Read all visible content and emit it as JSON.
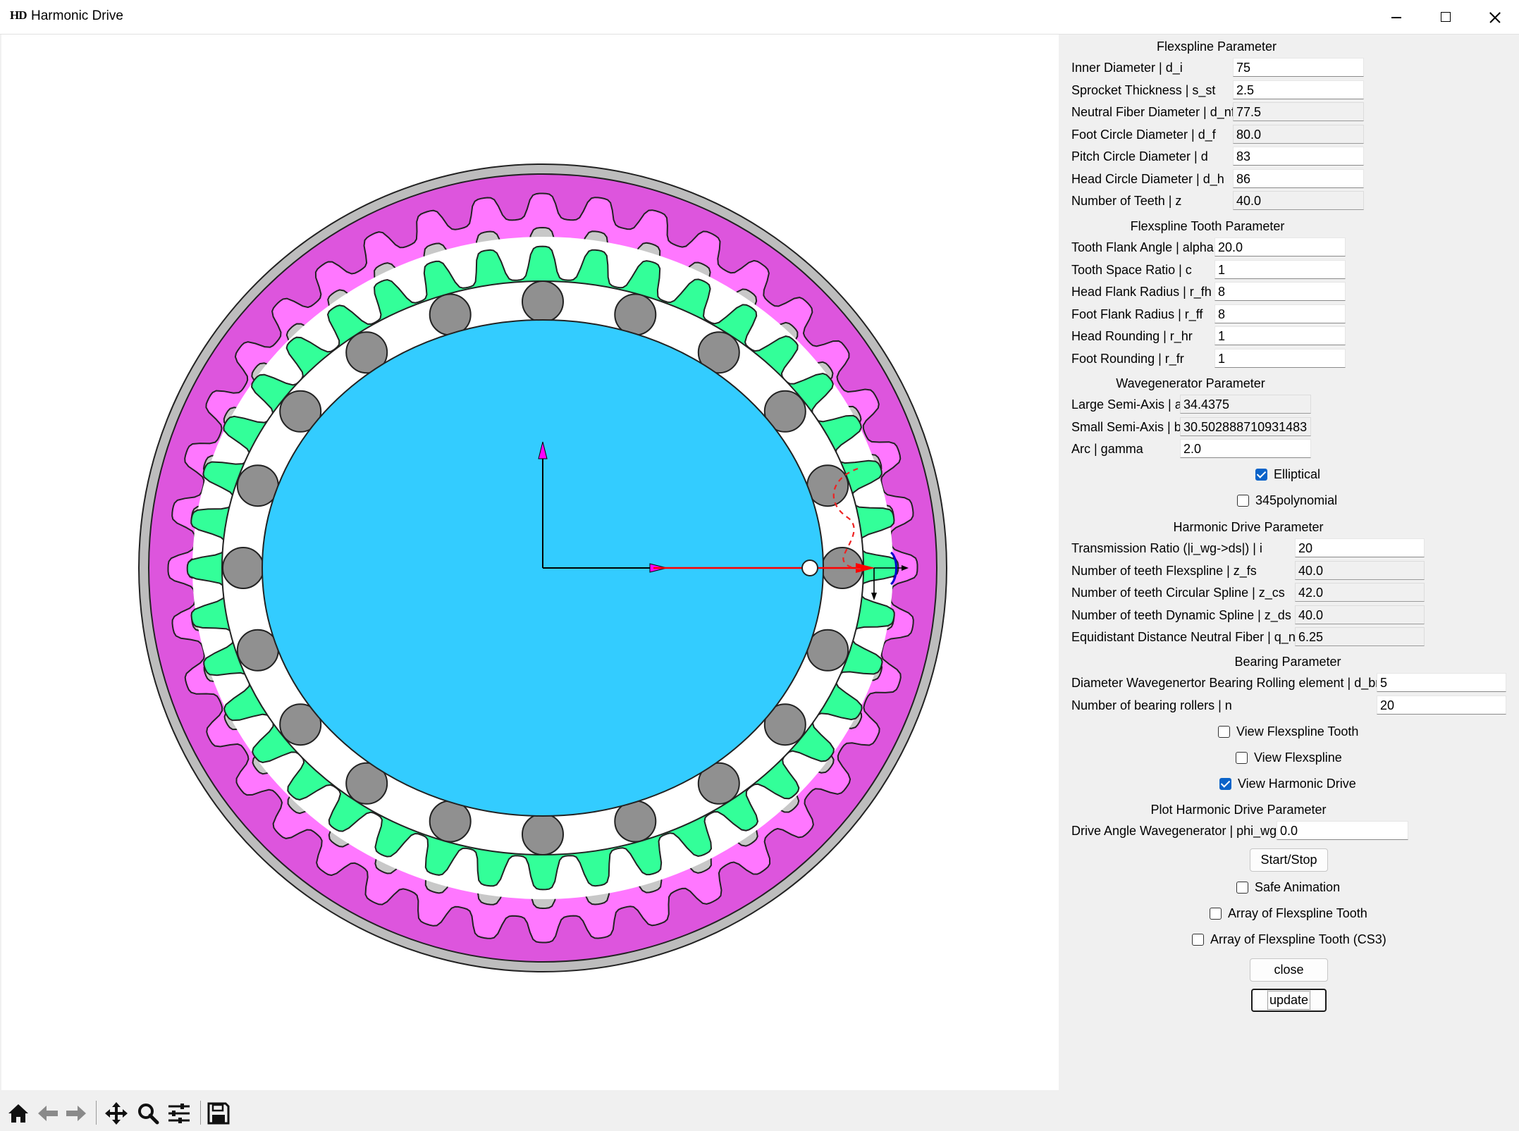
{
  "window": {
    "icon_text": "HD",
    "title": "Harmonic Drive"
  },
  "icons": {
    "minimize": "minimize-icon",
    "maximize": "maximize-icon",
    "close": "close-icon",
    "toolbar": [
      "home-icon",
      "back-arrow-icon",
      "forward-arrow-icon",
      "pan-move-icon",
      "zoom-magnifier-icon",
      "configure-subplots-icon",
      "save-floppy-icon"
    ]
  },
  "colors": {
    "circular_spline_ring": "#bdbdbd",
    "dynamic_spline": "#dd55dd",
    "dynamic_spline_teeth": "#ff77ff",
    "flexspline": "#33ff99",
    "bearing_rollers": "#909090",
    "wave_generator": "#33ccff",
    "x_axis_arrow": "#ff0000",
    "axis_arrow_heads": "#ff00ff",
    "tooth_profile": "#0000cc"
  },
  "panel": {
    "flexspline": {
      "title": "Flexspline Parameter",
      "fields": [
        {
          "label": "Inner Diameter | d_i",
          "value": "75"
        },
        {
          "label": "Sprocket Thickness | s_st",
          "value": "2.5"
        },
        {
          "label": "Neutral Fiber Diameter | d_nf",
          "value": "77.5"
        },
        {
          "label": "Foot Circle Diameter | d_f",
          "value": "80.0"
        },
        {
          "label": "Pitch Circle Diameter | d",
          "value": "83"
        },
        {
          "label": "Head Circle Diameter | d_h",
          "value": "86"
        },
        {
          "label": "Number of Teeth | z",
          "value": "40.0"
        }
      ]
    },
    "tooth": {
      "title": "Flexspline Tooth Parameter",
      "fields": [
        {
          "label": "Tooth Flank Angle | alpha",
          "value": "20.0"
        },
        {
          "label": "Tooth Space Ratio | c",
          "value": "1"
        },
        {
          "label": "Head Flank Radius | r_fh",
          "value": "8"
        },
        {
          "label": "Foot Flank Radius | r_ff",
          "value": "8"
        },
        {
          "label": "Head Rounding | r_hr",
          "value": "1"
        },
        {
          "label": "Foot Rounding | r_fr",
          "value": "1"
        }
      ]
    },
    "wavegen": {
      "title": "Wavegenerator Parameter",
      "fields": [
        {
          "label": "Large Semi-Axis | a",
          "value": "34.4375"
        },
        {
          "label": "Small Semi-Axis | b",
          "value": "30.502888710931483"
        },
        {
          "label": "Arc | gamma",
          "value": "2.0"
        }
      ],
      "elliptical": "Elliptical",
      "polynomial": "345polynomial"
    },
    "hd": {
      "title": "Harmonic Drive Parameter",
      "fields": [
        {
          "label": "Transmission Ratio (|i_wg->ds|) | i",
          "value": "20"
        },
        {
          "label": "Number of teeth Flexspline | z_fs",
          "value": "40.0"
        },
        {
          "label": "Number of teeth Circular Spline | z_cs",
          "value": "42.0"
        },
        {
          "label": "Number of teeth Dynamic Spline | z_ds",
          "value": "40.0"
        },
        {
          "label": "Equidistant Distance Neutral Fiber | q_nf",
          "value": "6.25"
        }
      ]
    },
    "bearing": {
      "title": "Bearing Parameter",
      "fields": [
        {
          "label": "Diameter Wavegenertor Bearing Rolling element | d_br",
          "value": "5"
        },
        {
          "label": "Number of bearing rollers | n",
          "value": "20"
        }
      ]
    },
    "view": {
      "tooth": "View Flexspline Tooth",
      "flexspline": "View Flexspline",
      "harmonic_drive": "View Harmonic Drive"
    },
    "plot": {
      "title": "Plot Harmonic Drive Parameter",
      "field": {
        "label": "Drive Angle Wavegenerator | phi_wg",
        "value": "0.0"
      },
      "start_stop": "Start/Stop",
      "safe_animation": "Safe Animation",
      "array_tooth": "Array of Flexspline Tooth",
      "array_tooth_cs3": "Array of Flexspline Tooth (CS3)",
      "close": "close",
      "update": "update"
    }
  }
}
